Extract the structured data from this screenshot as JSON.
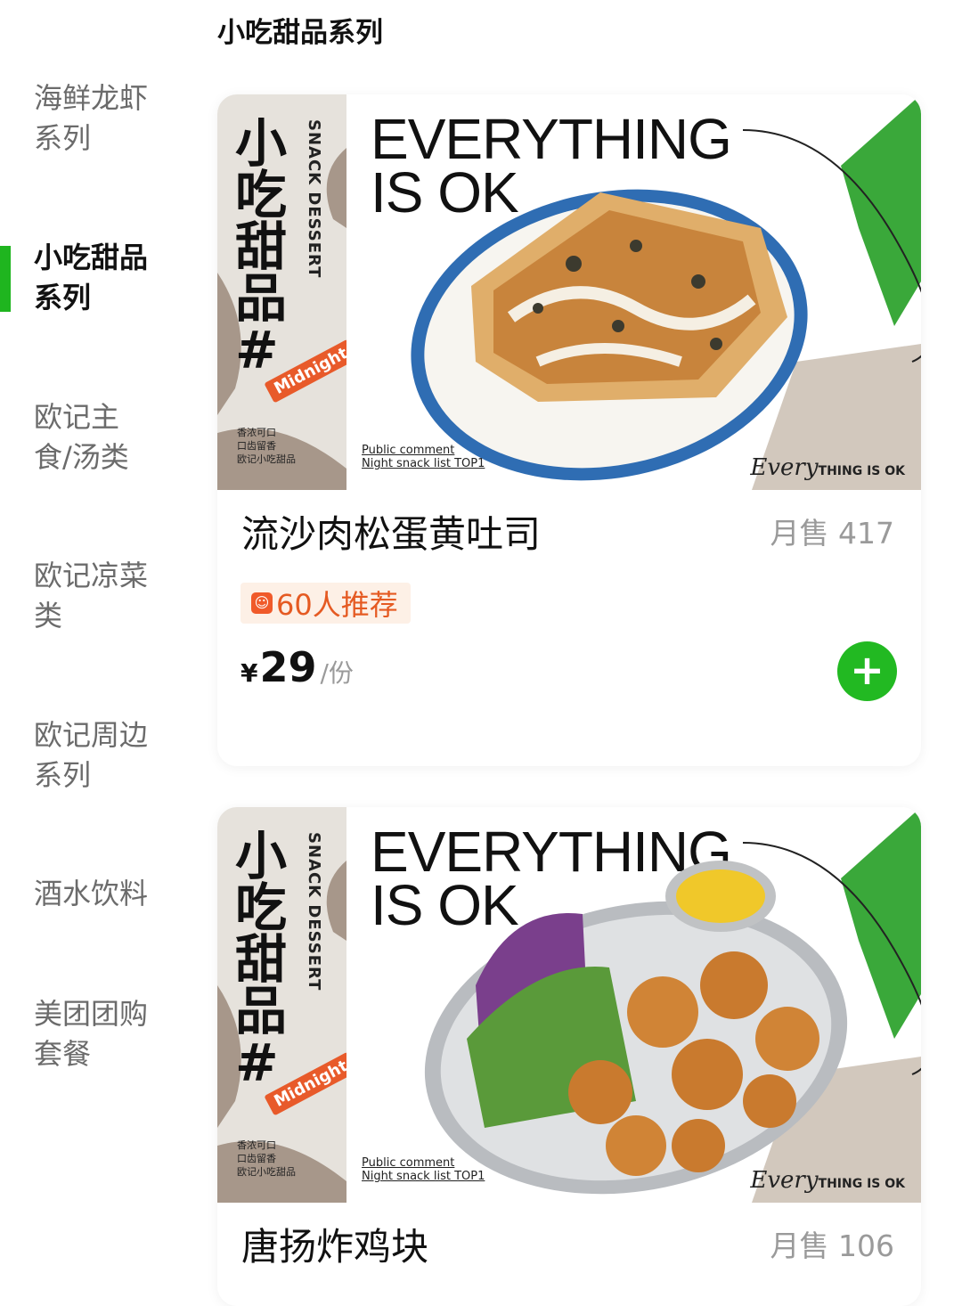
{
  "sidebar": {
    "items": [
      {
        "label_l1": "海鲜龙虾",
        "label_l2": "系列"
      },
      {
        "label_l1": "小吃甜品",
        "label_l2": "系列"
      },
      {
        "label_l1": "欧记主",
        "label_l2": "食/汤类"
      },
      {
        "label_l1": "欧记凉菜",
        "label_l2": "类"
      },
      {
        "label_l1": "欧记周边",
        "label_l2": "系列"
      },
      {
        "label_l1": "酒水饮料",
        "label_l2": ""
      },
      {
        "label_l1": "美团团购",
        "label_l2": "套餐"
      }
    ],
    "active_index": 1
  },
  "section": {
    "title": "小吃甜品系列"
  },
  "products": [
    {
      "name": "流沙肉松蛋黄吐司",
      "sales": "月售 417",
      "recommend": "60人推荐",
      "price_symbol": "¥",
      "price": "29",
      "unit": "/份",
      "image": {
        "banner_zh": "小吃甜品#",
        "banner_en": "SNACK DESSERT",
        "banner_tag": "Midnight",
        "banner_small": [
          "香浓可口",
          "口齿留香",
          "欧记小吃甜品"
        ],
        "headline_1": "EVERYTHING",
        "headline_2": "IS OK",
        "public_1": "Public comment",
        "public_2": "Night snack list TOP1",
        "brand_script": "Every",
        "brand_rest": "THING IS OK"
      }
    },
    {
      "name": "唐扬炸鸡块",
      "sales": "月售 106",
      "image": {
        "banner_zh": "小吃甜品#",
        "banner_en": "SNACK DESSERT",
        "banner_tag": "Midnight",
        "banner_small": [
          "香浓可口",
          "口齿留香",
          "欧记小吃甜品"
        ],
        "headline_1": "EVERYTHING",
        "headline_2": "IS OK",
        "public_1": "Public comment",
        "public_2": "Night snack list TOP1",
        "brand_script": "Every",
        "brand_rest": "THING IS OK"
      }
    }
  ],
  "colors": {
    "accent": "#22b922",
    "recommend": "#e55a22",
    "muted": "#9a9a9a"
  }
}
